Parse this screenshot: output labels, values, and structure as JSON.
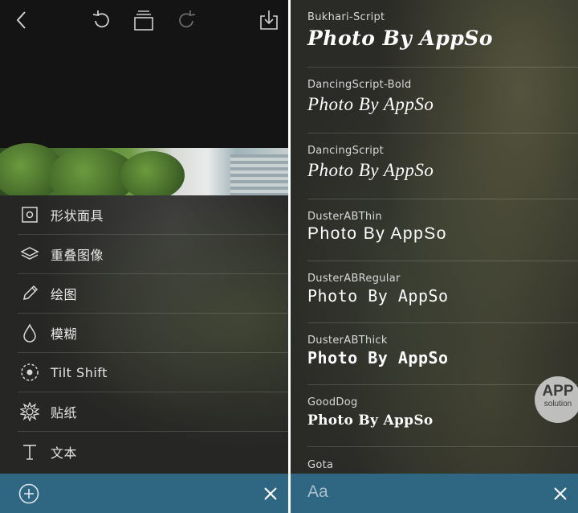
{
  "left_panel": {
    "topbar": {
      "back_icon": "chevron-left-icon",
      "undo_icon": "undo-icon",
      "layers_icon": "layers-stack-icon",
      "redo_icon": "redo-icon",
      "export_icon": "share-export-icon"
    },
    "menu": {
      "items": [
        {
          "icon": "shape-mask-icon",
          "label": "形状面具"
        },
        {
          "icon": "layers-icon",
          "label": "重叠图像"
        },
        {
          "icon": "pencil-icon",
          "label": "绘图"
        },
        {
          "icon": "drop-icon",
          "label": "模糊"
        },
        {
          "icon": "tilt-shift-icon",
          "label": "Tilt Shift"
        },
        {
          "icon": "sticker-icon",
          "label": "贴纸"
        },
        {
          "icon": "text-icon",
          "label": "文本"
        }
      ]
    },
    "bottombar": {
      "add_icon": "plus-circle-icon",
      "close_icon": "close-icon"
    }
  },
  "right_panel": {
    "fonts": [
      {
        "name": "Bukhari-Script",
        "sample": "Photo By AppSo"
      },
      {
        "name": "DancingScript-Bold",
        "sample": "Photo By AppSo"
      },
      {
        "name": "DancingScript",
        "sample": "Photo By AppSo"
      },
      {
        "name": "DusterABThin",
        "sample": "Photo By AppSo"
      },
      {
        "name": "DusterABRegular",
        "sample": "Photo By AppSo"
      },
      {
        "name": "DusterABThick",
        "sample": "Photo By AppSo"
      },
      {
        "name": "GoodDog",
        "sample": "Photo By AppSo"
      },
      {
        "name": "Gota",
        "sample": ""
      }
    ],
    "bottombar": {
      "font_label": "Aa",
      "close_icon": "close-icon"
    }
  },
  "watermark": {
    "line1": "APP",
    "line2": "solution"
  },
  "colors": {
    "bottombar": "#2f6783",
    "menu_text": "#e6e6e6",
    "font_name_text": "#d8d8d8"
  }
}
